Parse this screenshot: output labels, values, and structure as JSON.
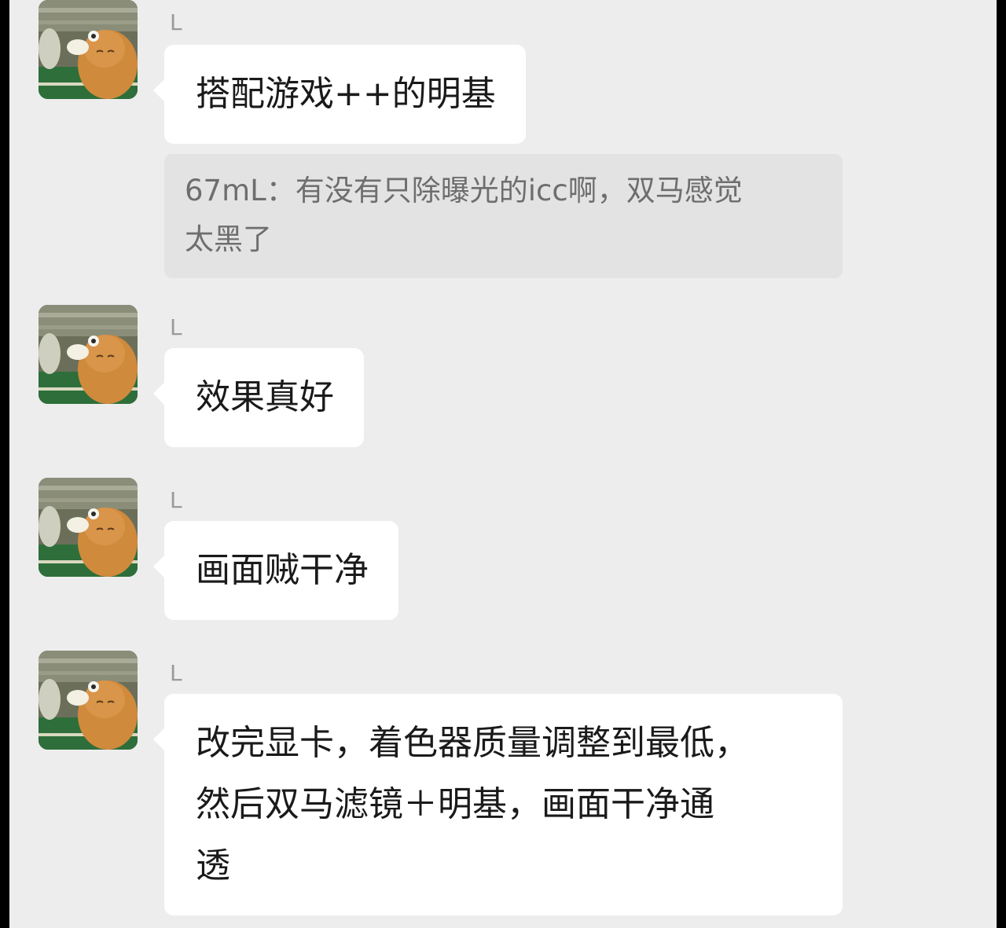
{
  "theme": {
    "background": "#ededed",
    "bubble": "#ffffff",
    "quote_bubble": "#e3e3e3",
    "sender_color": "#9a9a9a"
  },
  "messages": [
    {
      "sender": "L",
      "avatar_icon": "cat-avatar-icon",
      "lines": [
        "搭配游戏++的明基"
      ],
      "quote": {
        "lines": [
          "67mL：有没有只除曝光的icc啊，双马感觉",
          "太黑了"
        ]
      }
    },
    {
      "sender": "L",
      "avatar_icon": "cat-avatar-icon",
      "lines": [
        "效果真好"
      ]
    },
    {
      "sender": "L",
      "avatar_icon": "cat-avatar-icon",
      "lines": [
        "画面贼干净"
      ]
    },
    {
      "sender": "L",
      "avatar_icon": "cat-avatar-icon",
      "lines": [
        "改完显卡，着色器质量调整到最低，",
        "然后双马滤镜＋明基，画面干净通",
        "透"
      ]
    }
  ]
}
